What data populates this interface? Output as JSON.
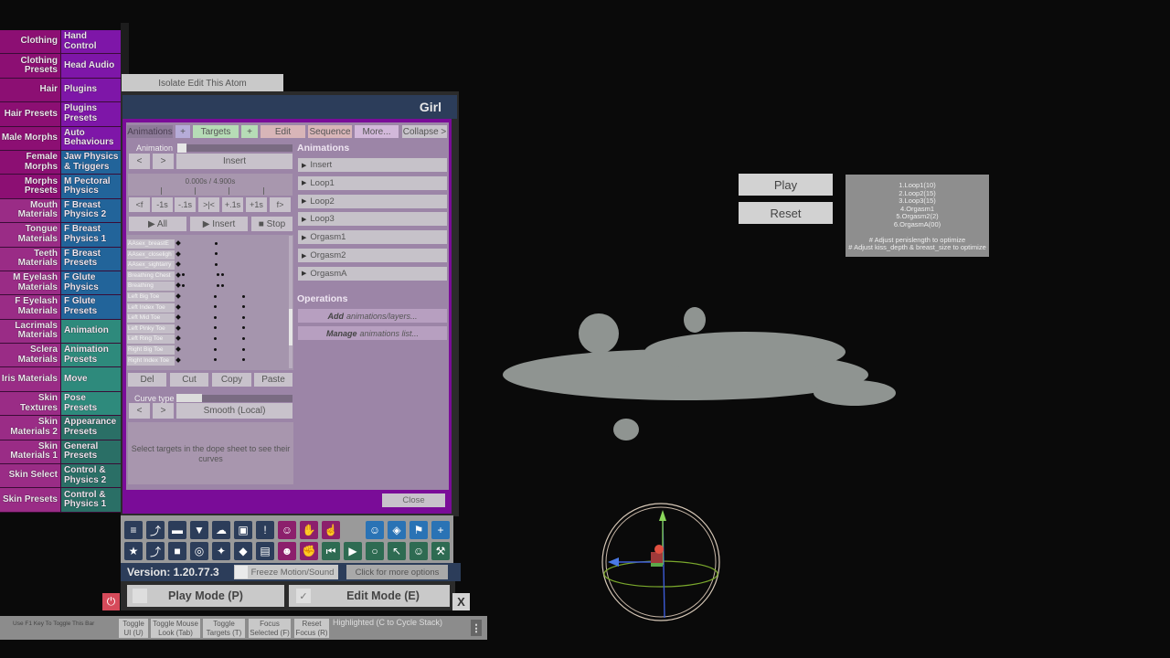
{
  "left_tabs": [
    {
      "left": "Clothing",
      "right": "Hand Control",
      "lc": "c-mag",
      "rc": "c-pur"
    },
    {
      "left": "Clothing Presets",
      "right": "Head Audio",
      "lc": "c-mag",
      "rc": "c-pur"
    },
    {
      "left": "Hair",
      "right": "Plugins",
      "lc": "c-mag",
      "rc": "c-pur"
    },
    {
      "left": "Hair Presets",
      "right": "Plugins Presets",
      "lc": "c-mag",
      "rc": "c-pur"
    },
    {
      "left": "Male Morphs",
      "right": "Auto Behaviours",
      "lc": "c-mag",
      "rc": "c-pur"
    },
    {
      "left": "Female Morphs",
      "right": "Jaw Physics & Triggers",
      "lc": "c-mag",
      "rc": "c-blue"
    },
    {
      "left": "Morphs Presets",
      "right": "M Pectoral Physics",
      "lc": "c-mag",
      "rc": "c-blue"
    },
    {
      "left": "Mouth Materials",
      "right": "F Breast Physics 2",
      "lc": "c-mag2",
      "rc": "c-blue"
    },
    {
      "left": "Tongue Materials",
      "right": "F Breast Physics 1",
      "lc": "c-mag2",
      "rc": "c-blue"
    },
    {
      "left": "Teeth Materials",
      "right": "F Breast Presets",
      "lc": "c-mag2",
      "rc": "c-blue"
    },
    {
      "left": "M Eyelash Materials",
      "right": "F Glute Physics",
      "lc": "c-mag2",
      "rc": "c-blue"
    },
    {
      "left": "F Eyelash Materials",
      "right": "F Glute Presets",
      "lc": "c-mag2",
      "rc": "c-blue"
    },
    {
      "left": "Lacrimals Materials",
      "right": "Animation",
      "lc": "c-mag2",
      "rc": "c-teal"
    },
    {
      "left": "Sclera Materials",
      "right": "Animation Presets",
      "lc": "c-mag2",
      "rc": "c-teal"
    },
    {
      "left": "Iris Materials",
      "right": "Move",
      "lc": "c-mag2",
      "rc": "c-teal"
    },
    {
      "left": "Skin Textures",
      "right": "Pose Presets",
      "lc": "c-mag2",
      "rc": "c-teal"
    },
    {
      "left": "Skin Materials 2",
      "right": "Appearance Presets",
      "lc": "c-mag2",
      "rc": "c-teal2"
    },
    {
      "left": "Skin Materials 1",
      "right": "General Presets",
      "lc": "c-mag2",
      "rc": "c-teal2"
    },
    {
      "left": "Skin Select",
      "right": "Control & Physics 2",
      "lc": "c-mag2",
      "rc": "c-teal2"
    },
    {
      "left": "Skin Presets",
      "right": "Control & Physics 1",
      "lc": "c-mag2",
      "rc": "c-teal2"
    }
  ],
  "isolate_button": "Isolate Edit This Atom",
  "panel": {
    "title": "Girl",
    "tabs": {
      "animations": "Animations",
      "plus1": "+",
      "targets": "Targets",
      "plus2": "+",
      "edit": "Edit",
      "sequence": "Sequence",
      "more": "More...",
      "collapse": "Collapse >"
    },
    "animation_label": "Animation",
    "prev": "<",
    "next": ">",
    "current_animation": "Insert",
    "time_display": "0.000s / 4.900s",
    "time_buttons": [
      "<f",
      "-1s",
      "-.1s",
      ">|<",
      "+.1s",
      "+1s",
      "f>"
    ],
    "play_all": "▶ All",
    "play_insert": "▶ Insert",
    "stop": "■ Stop",
    "dope_targets": [
      "AAsex_breastE",
      "AAsex_closeligh",
      "AAsex_sightarry",
      "Breathing Chest",
      "Breathing",
      "Left Big Toe",
      "Left Index Toe",
      "Left Mid Toe",
      "Left Pinky Toe",
      "Left Ring Toe",
      "Right Big Toe",
      "Right Index Toe"
    ],
    "edit_buttons": {
      "del": "Del",
      "cut": "Cut",
      "copy": "Copy",
      "paste": "Paste"
    },
    "curve_type_label": "Curve type",
    "curve_type_value": "Smooth (Local)",
    "curves_hint": "Select targets in the dope sheet to see their curves",
    "animations_header": "Animations",
    "animations_list": [
      "Insert",
      "Loop1",
      "Loop2",
      "Loop3",
      "Orgasm1",
      "Orgasm2",
      "OrgasmA"
    ],
    "operations_header": "Operations",
    "op_add_bold": "Add",
    "op_add_rest": "animations/layers...",
    "op_manage_bold": "Manage",
    "op_manage_rest": "animations list...",
    "close": "Close"
  },
  "toolbar": {
    "version": "Version: 1.20.77.3",
    "freeze": "Freeze Motion/Sound",
    "more_options": "Click for more options",
    "play_mode": "Play Mode (P)",
    "edit_mode": "Edit Mode (E)",
    "edit_mode_checked": "✓",
    "close_x": "X",
    "power": "⏻"
  },
  "bottom_bar": {
    "hint": "Use F1 Key To Toggle This Bar",
    "buttons": [
      "Toggle UI (U)",
      "Toggle Mouse Look (Tab)",
      "Toggle Targets (T)",
      "Focus Selected (F)",
      "Reset Focus (R)"
    ],
    "status": "Highlighted (C to Cycle Stack)",
    "menu": "⋮"
  },
  "scene": {
    "play": "Play",
    "reset": "Reset",
    "notes": [
      "1.Loop1(10)",
      "2.Loop2(15)",
      "3.Loop3(15)",
      "4.Orgasm1",
      "5.Orgasm2(2)",
      "6.OrgasmA(00)",
      "",
      "# Adjust penislength to optimize",
      "# Adjust kiss_depth & breast_size to optimize"
    ]
  }
}
